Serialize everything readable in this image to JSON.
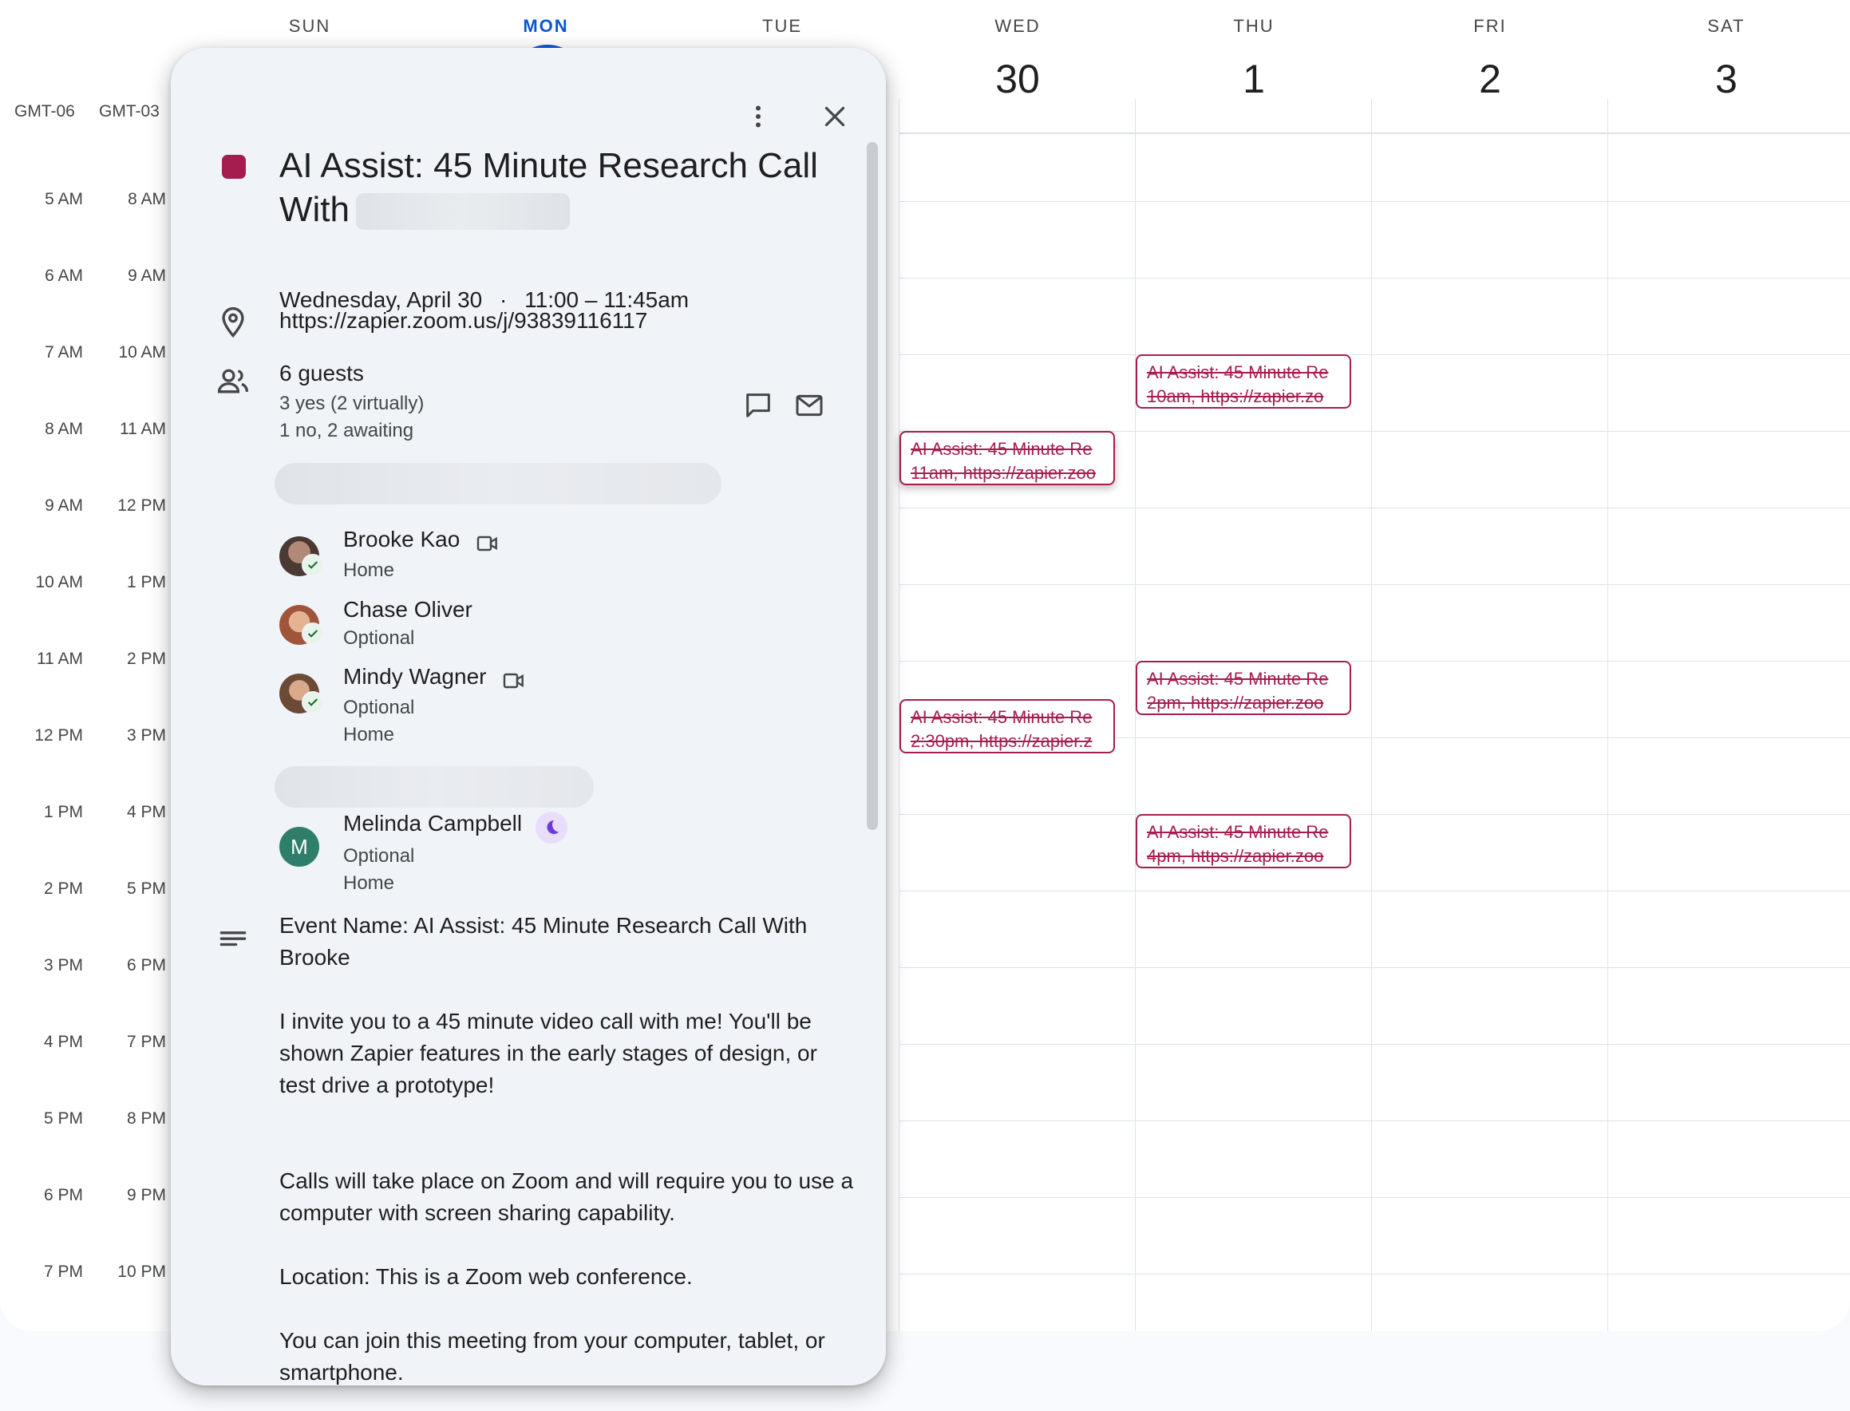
{
  "calendar": {
    "days": [
      {
        "name": "SUN",
        "num": ""
      },
      {
        "name": "MON",
        "num": ""
      },
      {
        "name": "TUE",
        "num": ""
      },
      {
        "name": "WED",
        "num": "30"
      },
      {
        "name": "THU",
        "num": "1"
      },
      {
        "name": "FRI",
        "num": "2"
      },
      {
        "name": "SAT",
        "num": "3"
      }
    ],
    "timezones": [
      "GMT-06",
      "GMT-03"
    ],
    "hours_primary": [
      "5 AM",
      "6 AM",
      "7 AM",
      "8 AM",
      "9 AM",
      "10 AM",
      "11 AM",
      "12 PM",
      "1 PM",
      "2 PM",
      "3 PM",
      "4 PM",
      "5 PM",
      "6 PM",
      "7 PM"
    ],
    "hours_secondary": [
      "8 AM",
      "9 AM",
      "10 AM",
      "11 AM",
      "12 PM",
      "1 PM",
      "2 PM",
      "3 PM",
      "4 PM",
      "5 PM",
      "6 PM",
      "7 PM",
      "8 PM",
      "9 PM",
      "10 PM"
    ],
    "events": [
      {
        "line1": "AI Assist: 45 Minute Re",
        "line2": "10am, https://zapier.zo"
      },
      {
        "line1": "AI Assist: 45 Minute Re",
        "line2": "11am, https://zapier.zoo"
      },
      {
        "line1": "AI Assist: 45 Minute Re",
        "line2": "2pm, https://zapier.zoo"
      },
      {
        "line1": "AI Assist: 45 Minute Re",
        "line2": "2:30pm, https://zapier.z"
      },
      {
        "line1": "AI Assist: 45 Minute Re",
        "line2": "4pm, https://zapier.zoo"
      }
    ],
    "event_color": "#a51d4f"
  },
  "popup": {
    "title": "AI Assist: 45 Minute Research Call With",
    "date": "Wednesday, April 30",
    "separator": "·",
    "time": "11:00 – 11:45am",
    "location": "https://zapier.zoom.us/j/93839116117",
    "guests_count": "6 guests",
    "guests_yes": "3 yes (2 virtually)",
    "guests_other": "1 no, 2 awaiting",
    "guests": [
      {
        "name": "Brooke Kao",
        "line1": "Home",
        "line2": ""
      },
      {
        "name": "Chase Oliver",
        "line1": "Optional",
        "line2": ""
      },
      {
        "name": "Mindy Wagner",
        "line1": "Optional",
        "line2": "Home"
      },
      {
        "name": "Melinda Campbell",
        "initial": "M",
        "line1": "Optional",
        "line2": "Home"
      }
    ],
    "description": [
      "Event Name: AI Assist: 45 Minute Research Call With Brooke",
      "I invite you to a 45 minute video call with me! You'll be shown Zapier features in the early stages of design, or test drive a prototype!",
      "Calls will take place on Zoom and will require you to use a computer with screen sharing capability.",
      "Location: This is a Zoom web conference.",
      "You can join this meeting from your computer, tablet, or smartphone."
    ],
    "icons": [
      "more-vert-icon",
      "close-icon",
      "location-pin-icon",
      "people-icon",
      "chat-icon",
      "email-icon",
      "video-icon",
      "moon-icon",
      "notes-icon",
      "check-icon"
    ]
  }
}
